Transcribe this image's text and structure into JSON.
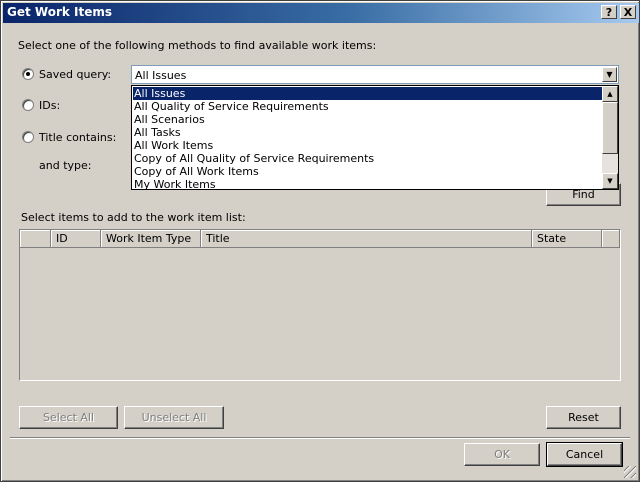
{
  "window": {
    "title": "Get Work Items",
    "help_label": "?",
    "close_label": "X"
  },
  "methods": {
    "instruction": "Select one of the following methods to find available work items:",
    "saved_query_label": "Saved query:",
    "ids_label": "IDs:",
    "title_contains_label": "Title contains:",
    "and_type_label": "and type:",
    "selected_method": "saved_query"
  },
  "saved_query": {
    "value": "All Issues",
    "options": [
      "All Issues",
      "All Quality of Service Requirements",
      "All Scenarios",
      "All Tasks",
      "All Work Items",
      "Copy of All Quality of Service Requirements",
      "Copy of All Work Items",
      "My Work Items"
    ],
    "selected_index": 0
  },
  "find_label": "Find",
  "results": {
    "instruction": "Select items to add to the work item list:",
    "columns": [
      "",
      "ID",
      "Work Item Type",
      "Title",
      "State",
      ""
    ],
    "rows": []
  },
  "buttons": {
    "select_all": "Select All",
    "unselect_all": "Unselect All",
    "reset": "Reset",
    "ok": "OK",
    "cancel": "Cancel"
  },
  "icons": {
    "combo_arrow": "chevron-down-icon",
    "scroll_up": "arrow-up-icon",
    "scroll_down": "arrow-down-icon",
    "resize": "resize-grip-icon"
  }
}
